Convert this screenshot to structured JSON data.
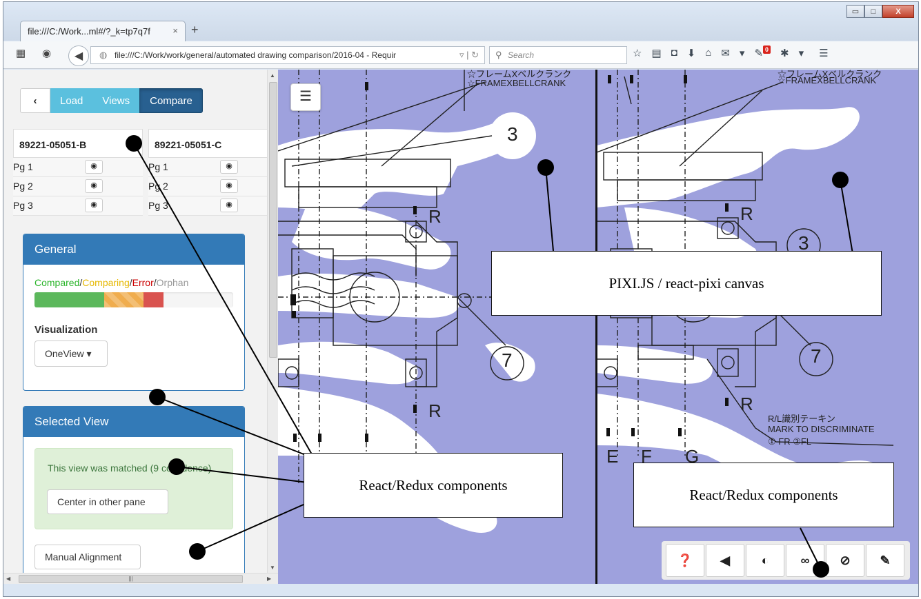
{
  "browser": {
    "tab_title": "file:///C:/Work...ml#/?_k=tp7q7f",
    "tab_close": "×",
    "new_tab": "+",
    "url": "file:///C:/Work/work/general/automated drawing comparison/2016-04 - Requir",
    "search_placeholder": "Search",
    "notification_count": "0",
    "window_buttons": {
      "minimize": "▭",
      "maximize": "□",
      "close": "X"
    }
  },
  "sidebar": {
    "nav": {
      "back": "‹",
      "load": "Load",
      "views": "Views",
      "compare": "Compare",
      "active": "compare"
    },
    "documents": [
      {
        "id": "89221-05051-B",
        "pages": [
          "Pg 1",
          "Pg 2",
          "Pg 3"
        ]
      },
      {
        "id": "89221-05051-C",
        "pages": [
          "Pg 1",
          "Pg 2",
          "Pg 3"
        ]
      }
    ],
    "general_panel": {
      "title": "General",
      "legend": {
        "compared": "Compared",
        "comparing": "Comparing",
        "error": "Error",
        "orphan": "Orphan",
        "sep": "/"
      },
      "progress": {
        "compared": 0.35,
        "comparing": 0.2,
        "error": 0.1
      },
      "colors": {
        "compared": "#5cb85c",
        "comparing": "#f0ad4e",
        "error": "#d9534f",
        "orphan": "#999999"
      },
      "visualization_label": "Visualization",
      "visualization_value": "OneView ▾"
    },
    "selected_view_panel": {
      "title": "Selected View",
      "alert_text": "This view was matched (9 confidence)",
      "center_button": "Center in other pane",
      "manual_alignment_button": "Manual Alignment"
    }
  },
  "canvas": {
    "menu_icon": "☰",
    "toolbar": [
      "help-icon",
      "prev-icon",
      "contrast-icon",
      "link-icon",
      "hide-icon",
      "pencil-icon"
    ],
    "drawing_text": {
      "title_jp": "☆フレームXベルクランク",
      "title_en": "☆FRAMEXBELLCRANK",
      "mark_jp": "R/L識別テーキン",
      "mark_en": "MARK TO DISCRIMINATE",
      "mark_codes": "① FR   ②FL",
      "circle_3": "3",
      "circle_7": "7",
      "letter_r": "R",
      "letter_e": "E",
      "letter_f": "F",
      "letter_g": "G"
    }
  },
  "annotations": {
    "canvas_label": "PIXI.JS / react-pixi canvas",
    "components_label": "React/Redux components"
  }
}
